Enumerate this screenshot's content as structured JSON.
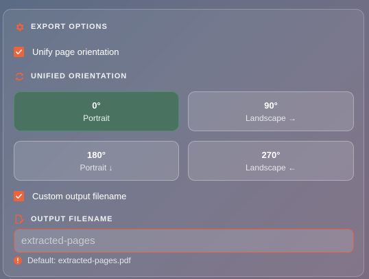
{
  "export_options": {
    "heading": "EXPORT OPTIONS",
    "icon": "gear-icon"
  },
  "unify_orientation": {
    "label": "Unify page orientation",
    "checked": true
  },
  "unified_orientation": {
    "heading": "UNIFIED ORIENTATION",
    "icon": "rotate-icon",
    "selected": "0°",
    "options": [
      {
        "degrees": "0°",
        "label": "Portrait"
      },
      {
        "degrees": "90°",
        "label": "Landscape →"
      },
      {
        "degrees": "180°",
        "label": "Portrait ↓"
      },
      {
        "degrees": "270°",
        "label": "Landscape ←"
      }
    ]
  },
  "custom_filename": {
    "label": "Custom output filename",
    "checked": true
  },
  "output_filename": {
    "heading": "OUTPUT FILENAME",
    "icon": "edit-file-icon",
    "placeholder": "extracted-pages",
    "value": "",
    "hint": "Default: extracted-pages.pdf",
    "hint_icon": "info-icon"
  },
  "colors": {
    "accent": "#f0623a",
    "selected_tile": "#4a7261"
  }
}
